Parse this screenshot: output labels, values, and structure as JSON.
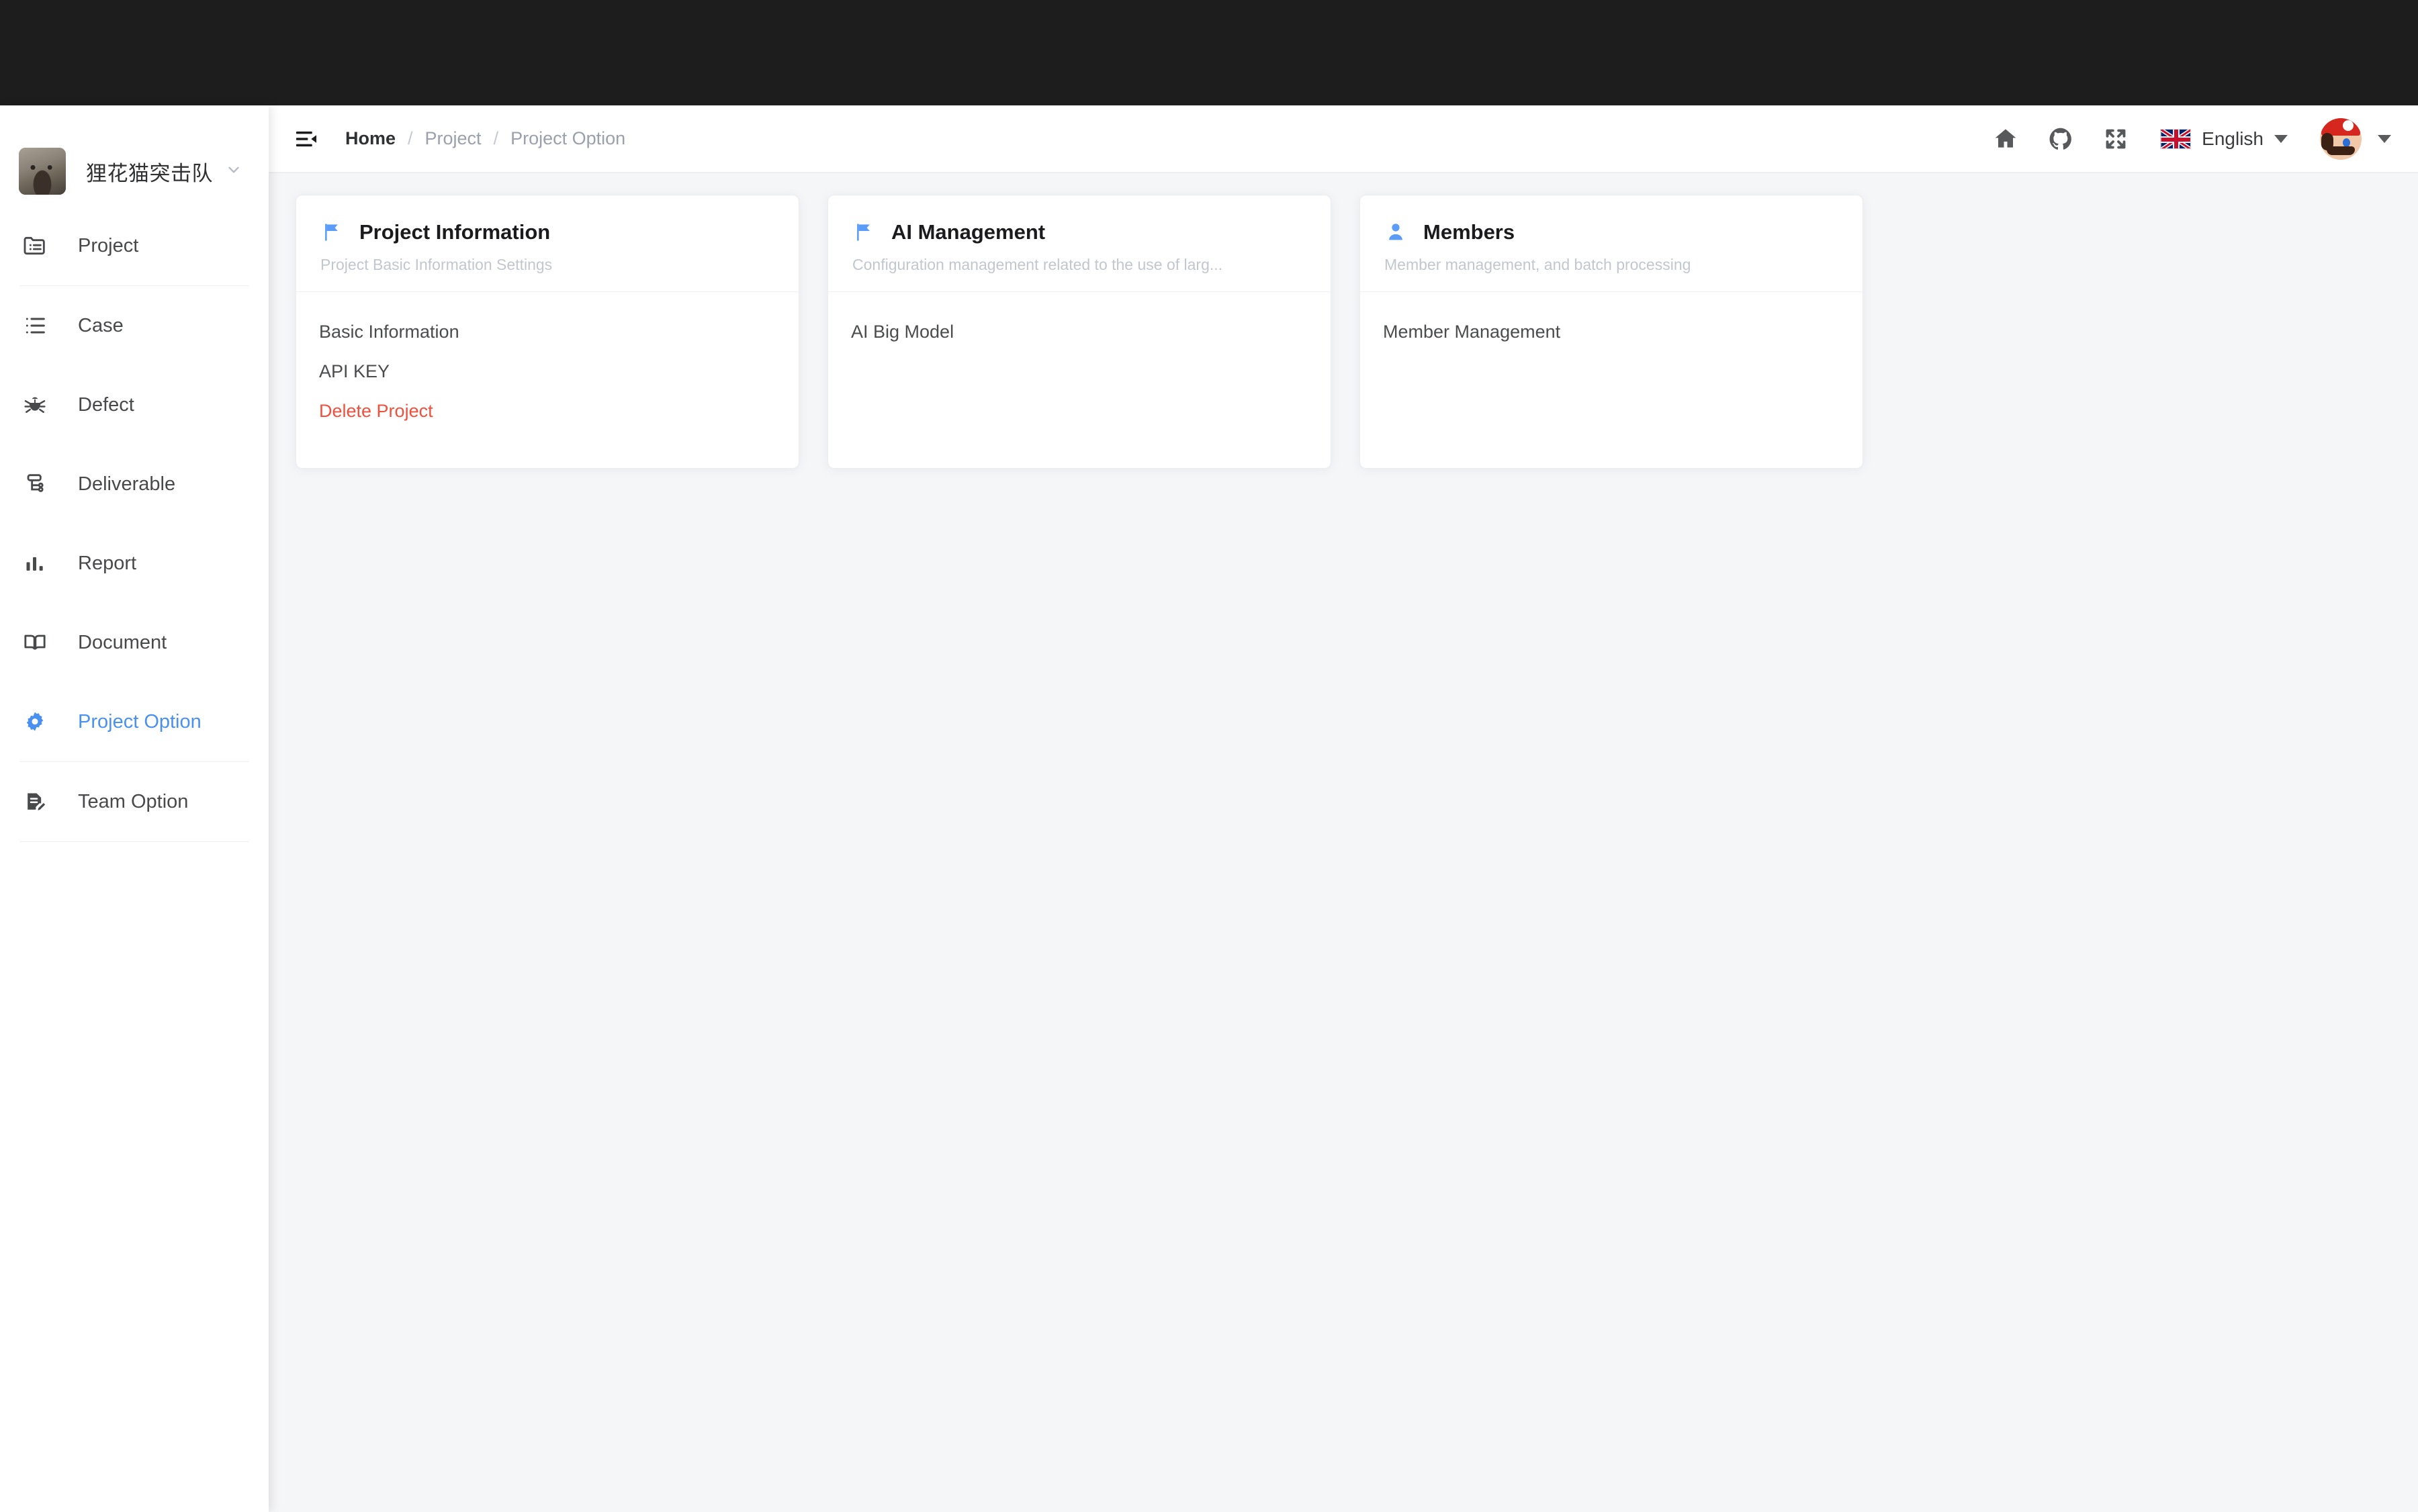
{
  "window": {
    "chrome_color": "#1d1d1d"
  },
  "sidebar": {
    "team": {
      "name": "狸花猫突击队",
      "avatar": "cat-avatar",
      "caret": "chevron-down-icon"
    },
    "items": [
      {
        "label": "Project",
        "icon": "folder-list-icon",
        "active": false
      },
      {
        "label": "Case",
        "icon": "ordered-list-icon",
        "active": false
      },
      {
        "label": "Defect",
        "icon": "bug-icon",
        "active": false
      },
      {
        "label": "Deliverable",
        "icon": "partition-tree-icon",
        "active": false
      },
      {
        "label": "Report",
        "icon": "bar-chart-icon",
        "active": false
      },
      {
        "label": "Document",
        "icon": "open-book-icon",
        "active": false
      },
      {
        "label": "Project Option",
        "icon": "gear-icon",
        "active": true
      },
      {
        "label": "Team Option",
        "icon": "file-edit-icon",
        "active": false
      }
    ],
    "active_color": "#4a90f0"
  },
  "header": {
    "fold_icon": "menu-fold-icon",
    "breadcrumb": [
      {
        "label": "Home",
        "current": true
      },
      {
        "label": "Project",
        "current": false
      },
      {
        "label": "Project Option",
        "current": false
      }
    ],
    "breadcrumb_separator": "/",
    "icons": [
      {
        "name": "home-icon"
      },
      {
        "name": "github-icon"
      },
      {
        "name": "fullscreen-icon"
      }
    ],
    "language": {
      "flag": "uk-flag-icon",
      "label": "English",
      "caret": "caret-down-icon"
    },
    "user": {
      "avatar": "mario-avatar",
      "caret": "caret-down-icon"
    }
  },
  "cards": [
    {
      "icon": "flag-icon",
      "title": "Project Information",
      "subtitle": "Project Basic Information Settings",
      "links": [
        {
          "label": "Basic Information",
          "danger": false
        },
        {
          "label": "API KEY",
          "danger": false
        },
        {
          "label": "Delete Project",
          "danger": true
        }
      ]
    },
    {
      "icon": "flag-icon",
      "title": "AI Management",
      "subtitle": "Configuration management related to the use of larg...",
      "links": [
        {
          "label": "AI Big Model",
          "danger": false
        }
      ]
    },
    {
      "icon": "user-icon",
      "title": "Members",
      "subtitle": "Member management, and batch processing",
      "links": [
        {
          "label": "Member Management",
          "danger": false
        }
      ]
    }
  ],
  "colors": {
    "accent": "#4a90f0",
    "card_icon": "#5b9cf8",
    "danger": "#f2503c",
    "page_bg": "#f5f6f8",
    "muted": "#c2c6ce"
  }
}
